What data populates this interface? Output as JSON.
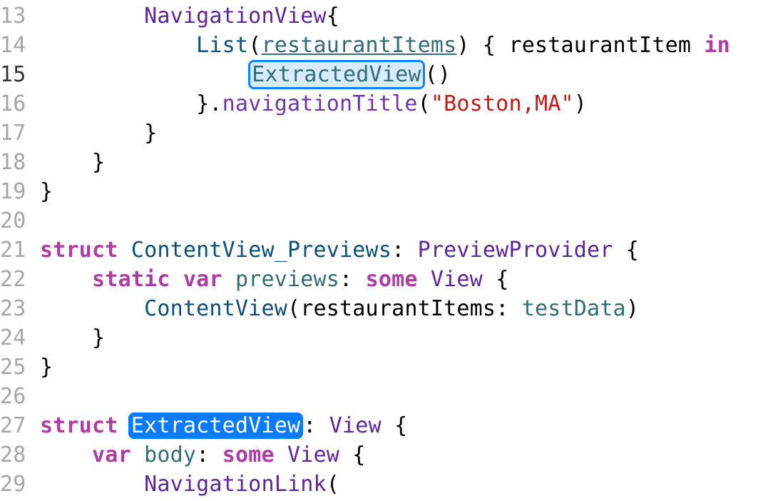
{
  "lines": {
    "l13": {
      "num": "13",
      "t0": "NavigationView"
    },
    "l14": {
      "num": "14",
      "t0": "List",
      "t1": "restaurantItems",
      "t2": "restaurantItem",
      "kw": "in"
    },
    "l15": {
      "num": "15",
      "t0": "ExtractedView"
    },
    "l16": {
      "num": "16",
      "t0": "navigationTitle",
      "str": "\"Boston,MA\""
    },
    "l17": {
      "num": "17"
    },
    "l18": {
      "num": "18"
    },
    "l19": {
      "num": "19"
    },
    "l20": {
      "num": "20"
    },
    "l21": {
      "num": "21",
      "kw0": "struct",
      "t0": "ContentView_Previews",
      "t1": "PreviewProvider"
    },
    "l22": {
      "num": "22",
      "kw0": "static",
      "kw1": "var",
      "t0": "previews",
      "kw2": "some",
      "t1": "View"
    },
    "l23": {
      "num": "23",
      "t0": "ContentView",
      "t1": "restaurantItems",
      "t2": "testData"
    },
    "l24": {
      "num": "24"
    },
    "l25": {
      "num": "25"
    },
    "l26": {
      "num": "26"
    },
    "l27": {
      "num": "27",
      "kw0": "struct",
      "t0": "ExtractedView",
      "t1": "View"
    },
    "l28": {
      "num": "28",
      "kw0": "var",
      "t0": "body",
      "kw1": "some",
      "t1": "View"
    },
    "l29": {
      "num": "29",
      "t0": "NavigationLink"
    }
  }
}
